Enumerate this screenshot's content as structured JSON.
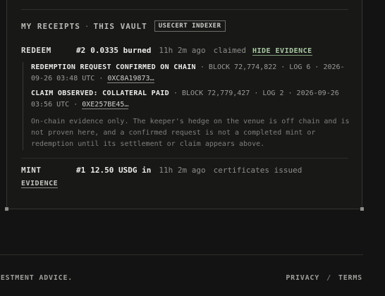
{
  "header": {
    "title": "MY RECEIPTS",
    "separator": "·",
    "subtitle": "THIS VAULT",
    "badge": "USECERT INDEXER"
  },
  "receipts": [
    {
      "kind": "REDEEM",
      "number": "#2",
      "amount": "0.0335 burned",
      "ago": "11h 2m ago",
      "status": "claimed",
      "toggle_label": "HIDE EVIDENCE",
      "evidence": [
        {
          "title": "REDEMPTION REQUEST CONFIRMED ON CHAIN",
          "meta": " · BLOCK 72,774,822 · LOG 6 · 2026-09-26 03:48 UTC · ",
          "link": "0XC8A19873…"
        },
        {
          "title": "CLAIM OBSERVED: COLLATERAL PAID",
          "meta": " · BLOCK 72,779,427 · LOG 2 · 2026-09-26 03:56 UTC · ",
          "link": "0XE257BE45…"
        }
      ],
      "note": "On-chain evidence only. The keeper's hedge on the venue is off chain and is not proven here, and a confirmed request is not a completed mint or redemption until its settlement or claim appears above."
    },
    {
      "kind": "MINT",
      "number": "#1",
      "amount": "12.50 USDG in",
      "ago": "11h 2m ago",
      "status": "certificates issued",
      "toggle_label": "EVIDENCE"
    }
  ],
  "footer": {
    "disclaimer": "VESTMENT ADVICE.",
    "links": [
      "PRIVACY",
      "TERMS"
    ],
    "separator": "/"
  }
}
